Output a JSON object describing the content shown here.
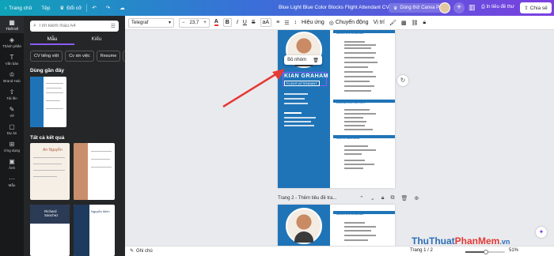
{
  "topbar": {
    "home": "Trang chủ",
    "file": "Tệp",
    "resize": "Đổi cỡ",
    "doc_title": "Blue Light Blue Color Blocks Flight Attendant CV",
    "try_pro": "Dùng thử Canva Pro",
    "print": "In tiêu đề thư",
    "share": "Chia sẻ"
  },
  "rail": [
    {
      "icon": "layout-icon",
      "label": "Thiết kế"
    },
    {
      "icon": "elements-icon",
      "label": "Thành phần"
    },
    {
      "icon": "text-icon",
      "label": "Văn bản"
    },
    {
      "icon": "brand-icon",
      "label": "Brand Hub"
    },
    {
      "icon": "upload-icon",
      "label": "Tải lên"
    },
    {
      "icon": "draw-icon",
      "label": "Vẽ"
    },
    {
      "icon": "projects-icon",
      "label": "Dự án"
    },
    {
      "icon": "apps-icon",
      "label": "Ứng dụng"
    },
    {
      "icon": "photos-icon",
      "label": "Ảnh"
    },
    {
      "icon": "more-icon",
      "label": "Mẫu"
    }
  ],
  "panel": {
    "search_placeholder": "Tìm kiếm mẫu A4",
    "tabs": [
      "Mẫu",
      "Kiểu"
    ],
    "chips": [
      "CV tiếng việt",
      "Cv xin việc",
      "Resume",
      "C"
    ],
    "recent_title": "Dùng gần đây",
    "results_title": "Tất cả kết quả",
    "thumb_names": [
      "An Nguyễn",
      "Richard Sanchez",
      "Nguyễn Minh"
    ]
  },
  "toolbar": {
    "font": "Telegraf",
    "size": "23,7",
    "spacing": "Hiệu ứng",
    "animate": "Chuyển động",
    "position": "Vị trí"
  },
  "canvas": {
    "popup_label": "Bỏ nhóm",
    "name": "KIAN GRAHAM",
    "job": "FLIGHT ATTENDANT",
    "page2_label": "Trang 2 - Thêm tiêu đề tra...",
    "section_heads": [
      "WORK EXPERIENCE",
      "EDUCATION HISTORY",
      "CERTIFICATIONS"
    ]
  },
  "bottom": {
    "notes": "Ghi chú",
    "pages": "Trang 1 / 2",
    "zoom": "51%",
    "zoom_fraction": 0.51
  },
  "watermark": {
    "part1": "ThuThuat",
    "part2": "PhanMem",
    "part3": ".vn"
  },
  "colors": {
    "accent": "#8b5cf6",
    "cv_blue": "#1f74b7",
    "arrow": "#e53935"
  }
}
